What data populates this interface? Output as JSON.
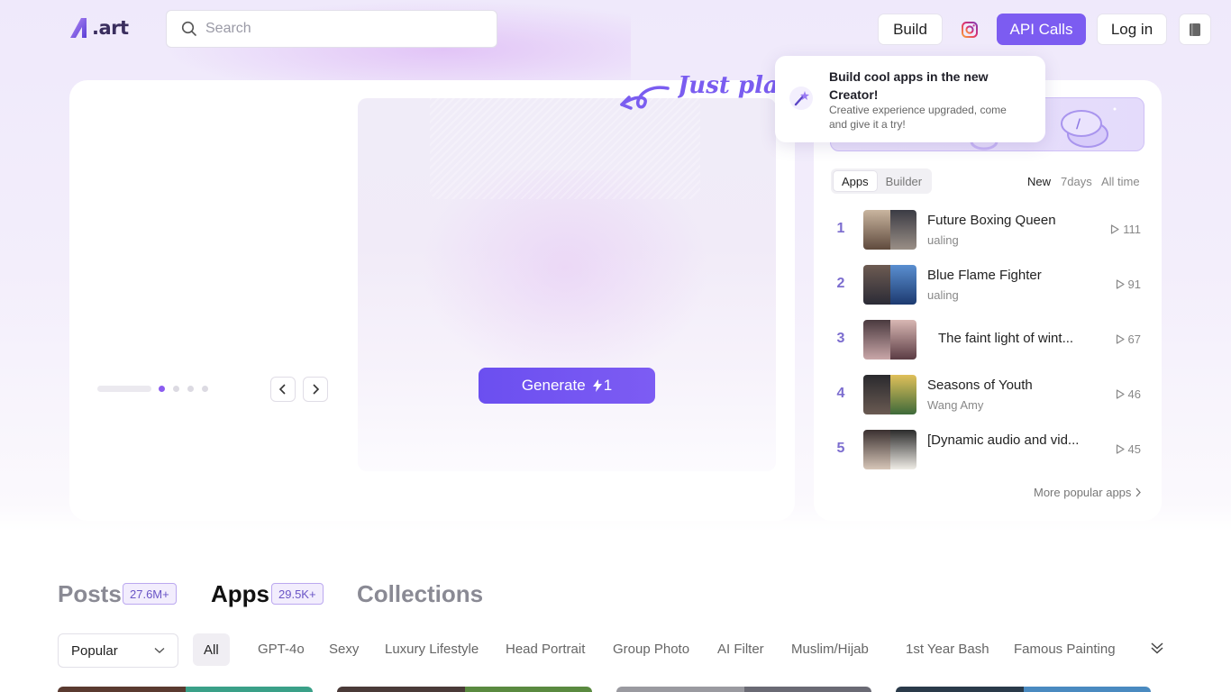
{
  "header": {
    "logo_text": ".art",
    "search_placeholder": "Search",
    "build_label": "Build",
    "instagram_icon": "instagram-icon",
    "api_label": "API Calls",
    "login_label": "Log in",
    "menu_icon": "book-icon"
  },
  "hero": {
    "handwritten_text": "Just play",
    "generate_label": "Generate",
    "generate_cost": "1",
    "carousel_active_index": 0,
    "carousel_count": 4
  },
  "tooltip": {
    "title": "Build cool apps in the new Creator!",
    "description": "Creative experience upgraded, come and give it a try!"
  },
  "ranking": {
    "tabs": [
      {
        "label": "Apps",
        "active": true
      },
      {
        "label": "Builder",
        "active": false
      }
    ],
    "time_filters": [
      {
        "label": "New",
        "active": true
      },
      {
        "label": "7days",
        "active": false
      },
      {
        "label": "All time",
        "active": false
      }
    ],
    "items": [
      {
        "rank": "1",
        "title": "Future Boxing Queen",
        "author": "ualing",
        "count": "111"
      },
      {
        "rank": "2",
        "title": "Blue Flame Fighter",
        "author": "ualing",
        "count": "91"
      },
      {
        "rank": "3",
        "title": "The faint light of wint...",
        "author": "",
        "count": "67"
      },
      {
        "rank": "4",
        "title": "Seasons of Youth",
        "author": "Wang Amy",
        "count": "46"
      },
      {
        "rank": "5",
        "title": "[Dynamic audio and vid...",
        "author": "",
        "count": "45"
      }
    ],
    "more_label": "More popular apps"
  },
  "sections": {
    "tabs": [
      {
        "label": "Posts",
        "count": "27.6M+",
        "active": false
      },
      {
        "label": "Apps",
        "count": "29.5K+",
        "active": true
      },
      {
        "label": "Collections",
        "count": "",
        "active": false
      }
    ]
  },
  "filters": {
    "sort_value": "Popular",
    "chips": [
      "All",
      "GPT-4o",
      "Sexy",
      "Luxury Lifestyle",
      "Head Portrait",
      "Group Photo",
      "AI Filter",
      "Muslim/Hijab",
      "1st Year Bash",
      "Famous Painting"
    ]
  },
  "colors": {
    "accent": "#7c5cf1",
    "rank_number": "#7c6dcf",
    "badge_border": "#bba8f0"
  }
}
